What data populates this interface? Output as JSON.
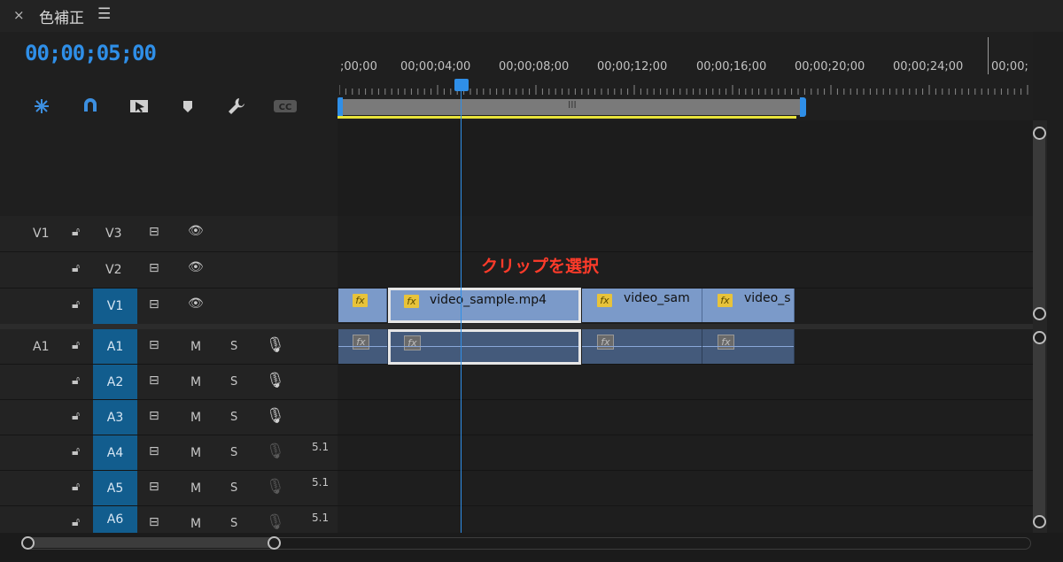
{
  "panel": {
    "close": "×",
    "title": "色補正",
    "menu": "☰"
  },
  "timecode": "00;00;05;00",
  "tools": [
    "snap-icon",
    "magnet-icon",
    "linked-selection-icon",
    "marker-icon",
    "wrench-icon",
    "captions-icon"
  ],
  "ruler": {
    "labels": [
      ";00;00",
      "00;00;04;00",
      "00;00;08;00",
      "00;00;12;00",
      "00;00;16;00",
      "00;00;20;00",
      "00;00;24;00",
      "00;00;"
    ],
    "grip": "III"
  },
  "tracks": {
    "video": [
      {
        "source": "V1",
        "target": "V3",
        "targeted": false
      },
      {
        "source": "",
        "target": "V2",
        "targeted": false
      },
      {
        "source": "",
        "target": "V1",
        "targeted": true
      }
    ],
    "audio": [
      {
        "source": "A1",
        "target": "A1",
        "mute": "M",
        "solo": "S",
        "channel": "",
        "mic_active": true
      },
      {
        "source": "",
        "target": "A2",
        "mute": "M",
        "solo": "S",
        "channel": "",
        "mic_active": true
      },
      {
        "source": "",
        "target": "A3",
        "mute": "M",
        "solo": "S",
        "channel": "",
        "mic_active": true
      },
      {
        "source": "",
        "target": "A4",
        "mute": "M",
        "solo": "S",
        "channel": "5.1",
        "mic_active": false
      },
      {
        "source": "",
        "target": "A5",
        "mute": "M",
        "solo": "S",
        "channel": "5.1",
        "mic_active": false
      },
      {
        "source": "",
        "target": "A6",
        "mute": "M",
        "solo": "S",
        "channel": "5.1",
        "mic_active": false
      }
    ]
  },
  "clips": {
    "fx": "fx",
    "video": [
      "",
      "video_sample.mp4",
      "video_sam",
      "video_s"
    ]
  },
  "annotation": "クリップを選択",
  "colors": {
    "accent": "#2f8fe8",
    "annotation": "#ff3b2a",
    "video_clip": "#7b9ac9",
    "audio_clip": "#445a7b",
    "target": "#125d8e",
    "work_area": "#e8e23a"
  }
}
